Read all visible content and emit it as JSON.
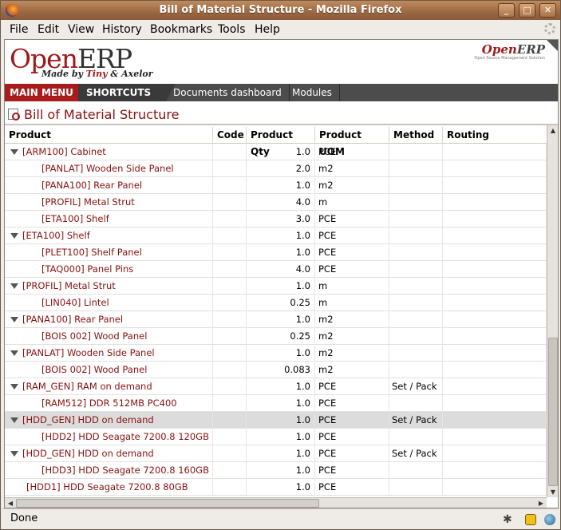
{
  "window": {
    "title": "Bill of Material Structure - Mozilla Firefox"
  },
  "menubar": {
    "items": [
      "File",
      "Edit",
      "View",
      "History",
      "Bookmarks",
      "Tools",
      "Help"
    ]
  },
  "header": {
    "logo_open": "Open",
    "logo_erp": "ERP",
    "made_by_prefix": "Made by ",
    "made_by_tiny": "Tiny",
    "made_by_suffix": " & Axelor",
    "small_logo_open": "Open",
    "small_logo_erp": "ERP",
    "small_logo_sub": "Open Source Management Solution"
  },
  "nav": {
    "main_menu": "MAIN MENU",
    "shortcuts": "SHORTCUTS",
    "shortcut_items": [
      "Documents dashboard",
      "Modules"
    ]
  },
  "page": {
    "title": "Bill of Material Structure"
  },
  "table": {
    "columns": [
      "Product",
      "Code",
      "Product Qty",
      "Product UOM",
      "Method",
      "Routing"
    ],
    "rows": [
      {
        "product": "[ARM100] Cabinet",
        "code": "",
        "qty": "1.0",
        "uom": "PCE",
        "method": "",
        "routing": ""
      },
      {
        "product": "[PANLAT] Wooden Side Panel",
        "code": "",
        "qty": "2.0",
        "uom": "m2",
        "method": "",
        "routing": ""
      },
      {
        "product": "[PANA100] Rear Panel",
        "code": "",
        "qty": "1.0",
        "uom": "m2",
        "method": "",
        "routing": ""
      },
      {
        "product": "[PROFIL] Metal Strut",
        "code": "",
        "qty": "4.0",
        "uom": "m",
        "method": "",
        "routing": ""
      },
      {
        "product": "[ETA100] Shelf",
        "code": "",
        "qty": "3.0",
        "uom": "PCE",
        "method": "",
        "routing": ""
      },
      {
        "product": "[ETA100] Shelf",
        "code": "",
        "qty": "1.0",
        "uom": "PCE",
        "method": "",
        "routing": ""
      },
      {
        "product": "[PLET100] Shelf Panel",
        "code": "",
        "qty": "1.0",
        "uom": "PCE",
        "method": "",
        "routing": ""
      },
      {
        "product": "[TAQ000] Panel Pins",
        "code": "",
        "qty": "4.0",
        "uom": "PCE",
        "method": "",
        "routing": ""
      },
      {
        "product": "[PROFIL] Metal Strut",
        "code": "",
        "qty": "1.0",
        "uom": "m",
        "method": "",
        "routing": ""
      },
      {
        "product": "[LIN040] Lintel",
        "code": "",
        "qty": "0.25",
        "uom": "m",
        "method": "",
        "routing": ""
      },
      {
        "product": "[PANA100] Rear Panel",
        "code": "",
        "qty": "1.0",
        "uom": "m2",
        "method": "",
        "routing": ""
      },
      {
        "product": "[BOIS 002] Wood Panel",
        "code": "",
        "qty": "0.25",
        "uom": "m2",
        "method": "",
        "routing": ""
      },
      {
        "product": "[PANLAT] Wooden Side Panel",
        "code": "",
        "qty": "1.0",
        "uom": "m2",
        "method": "",
        "routing": ""
      },
      {
        "product": "[BOIS 002] Wood Panel",
        "code": "",
        "qty": "0.083",
        "uom": "m2",
        "method": "",
        "routing": ""
      },
      {
        "product": "[RAM_GEN] RAM on demand",
        "code": "",
        "qty": "1.0",
        "uom": "PCE",
        "method": "Set / Pack",
        "routing": ""
      },
      {
        "product": "[RAM512] DDR 512MB PC400",
        "code": "",
        "qty": "1.0",
        "uom": "PCE",
        "method": "",
        "routing": ""
      },
      {
        "product": "[HDD_GEN] HDD on demand",
        "code": "",
        "qty": "1.0",
        "uom": "PCE",
        "method": "Set / Pack",
        "routing": ""
      },
      {
        "product": "[HDD2] HDD Seagate 7200.8 120GB",
        "code": "",
        "qty": "1.0",
        "uom": "PCE",
        "method": "",
        "routing": ""
      },
      {
        "product": "[HDD_GEN] HDD on demand",
        "code": "",
        "qty": "1.0",
        "uom": "PCE",
        "method": "Set / Pack",
        "routing": ""
      },
      {
        "product": "[HDD3] HDD Seagate 7200.8 160GB",
        "code": "",
        "qty": "1.0",
        "uom": "PCE",
        "method": "",
        "routing": ""
      },
      {
        "product": "[HDD1] HDD Seagate 7200.8 80GB",
        "code": "",
        "qty": "1.0",
        "uom": "PCE",
        "method": "",
        "routing": ""
      }
    ]
  },
  "status": {
    "text": "Done"
  },
  "colors": {
    "accent": "#a81c1c",
    "link": "#8a1010",
    "nav_bg": "#4c4c4c",
    "selected_row": "#dcdcdc"
  },
  "icons": [
    "firefox-icon",
    "page-icon",
    "expand-triangle-icon",
    "throbber-icon",
    "bug-icon",
    "extension-icon",
    "globe-icon"
  ]
}
